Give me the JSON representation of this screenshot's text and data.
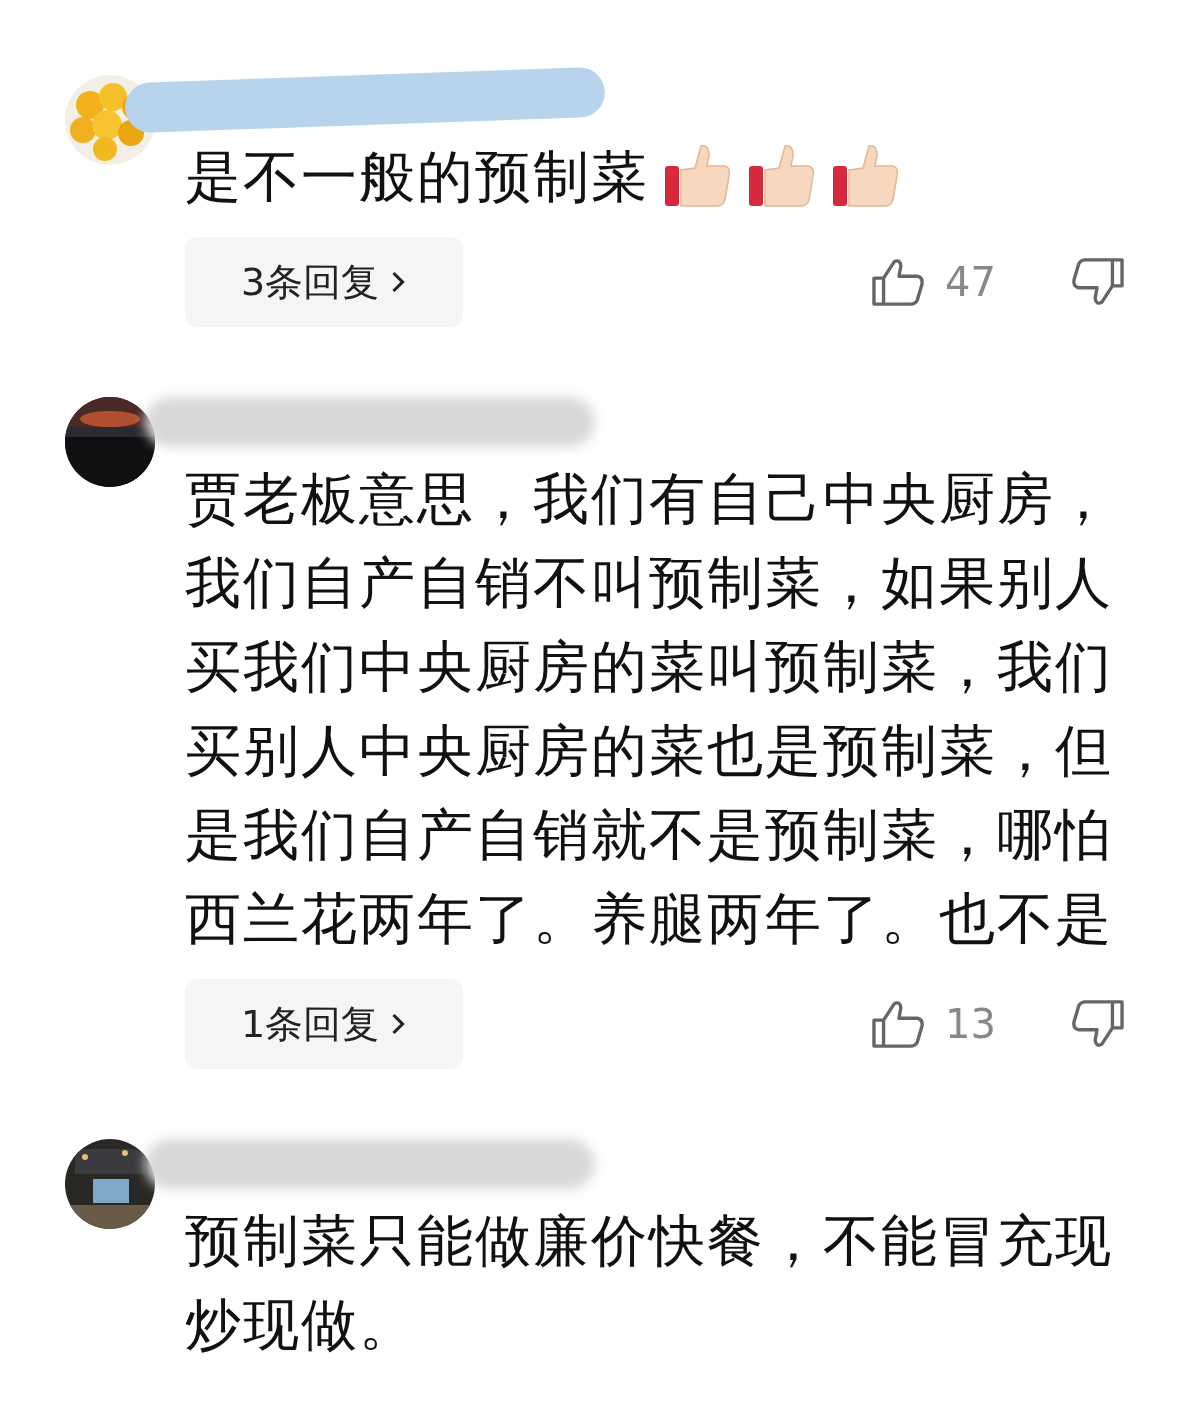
{
  "comments": [
    {
      "text": "是不一般的预制菜",
      "reactions": [
        {
          "kind": "thumbs-up"
        },
        {
          "kind": "thumbs-up"
        },
        {
          "kind": "thumbs-up"
        }
      ],
      "replies": "3条回复",
      "likes": "47"
    },
    {
      "text": "贾老板意思，我们有自己中央厨房，我们自产自销不叫预制菜，如果别人买我们中央厨房的菜叫预制菜，我们买别人中央厨房的菜也是预制菜，但是我们自产自销就不是预制菜，哪怕西兰花两年了。养腿两年了。也不是",
      "replies": "1条回复",
      "likes": "13"
    },
    {
      "text": "预制菜只能做廉价快餐，不能冒充现炒现做。"
    }
  ]
}
